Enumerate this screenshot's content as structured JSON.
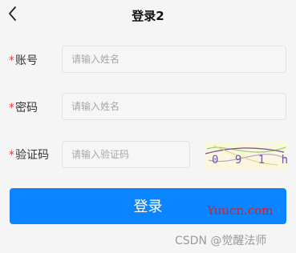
{
  "header": {
    "title": "登录2",
    "back_icon": "chevron-left-icon"
  },
  "form": {
    "required_mark": "*",
    "account": {
      "label": "账号",
      "placeholder": "请输入姓名",
      "value": ""
    },
    "password": {
      "label": "密码",
      "placeholder": "请输入姓名",
      "value": ""
    },
    "captcha": {
      "label": "验证码",
      "placeholder": "请输入验证码",
      "value": "",
      "image_text": "0 9 1 h"
    }
  },
  "login_button": {
    "label": "登录",
    "color": "#0a84ff"
  },
  "watermarks": {
    "site": "Yuucn.com",
    "author": "CSDN @觉醒法师"
  }
}
